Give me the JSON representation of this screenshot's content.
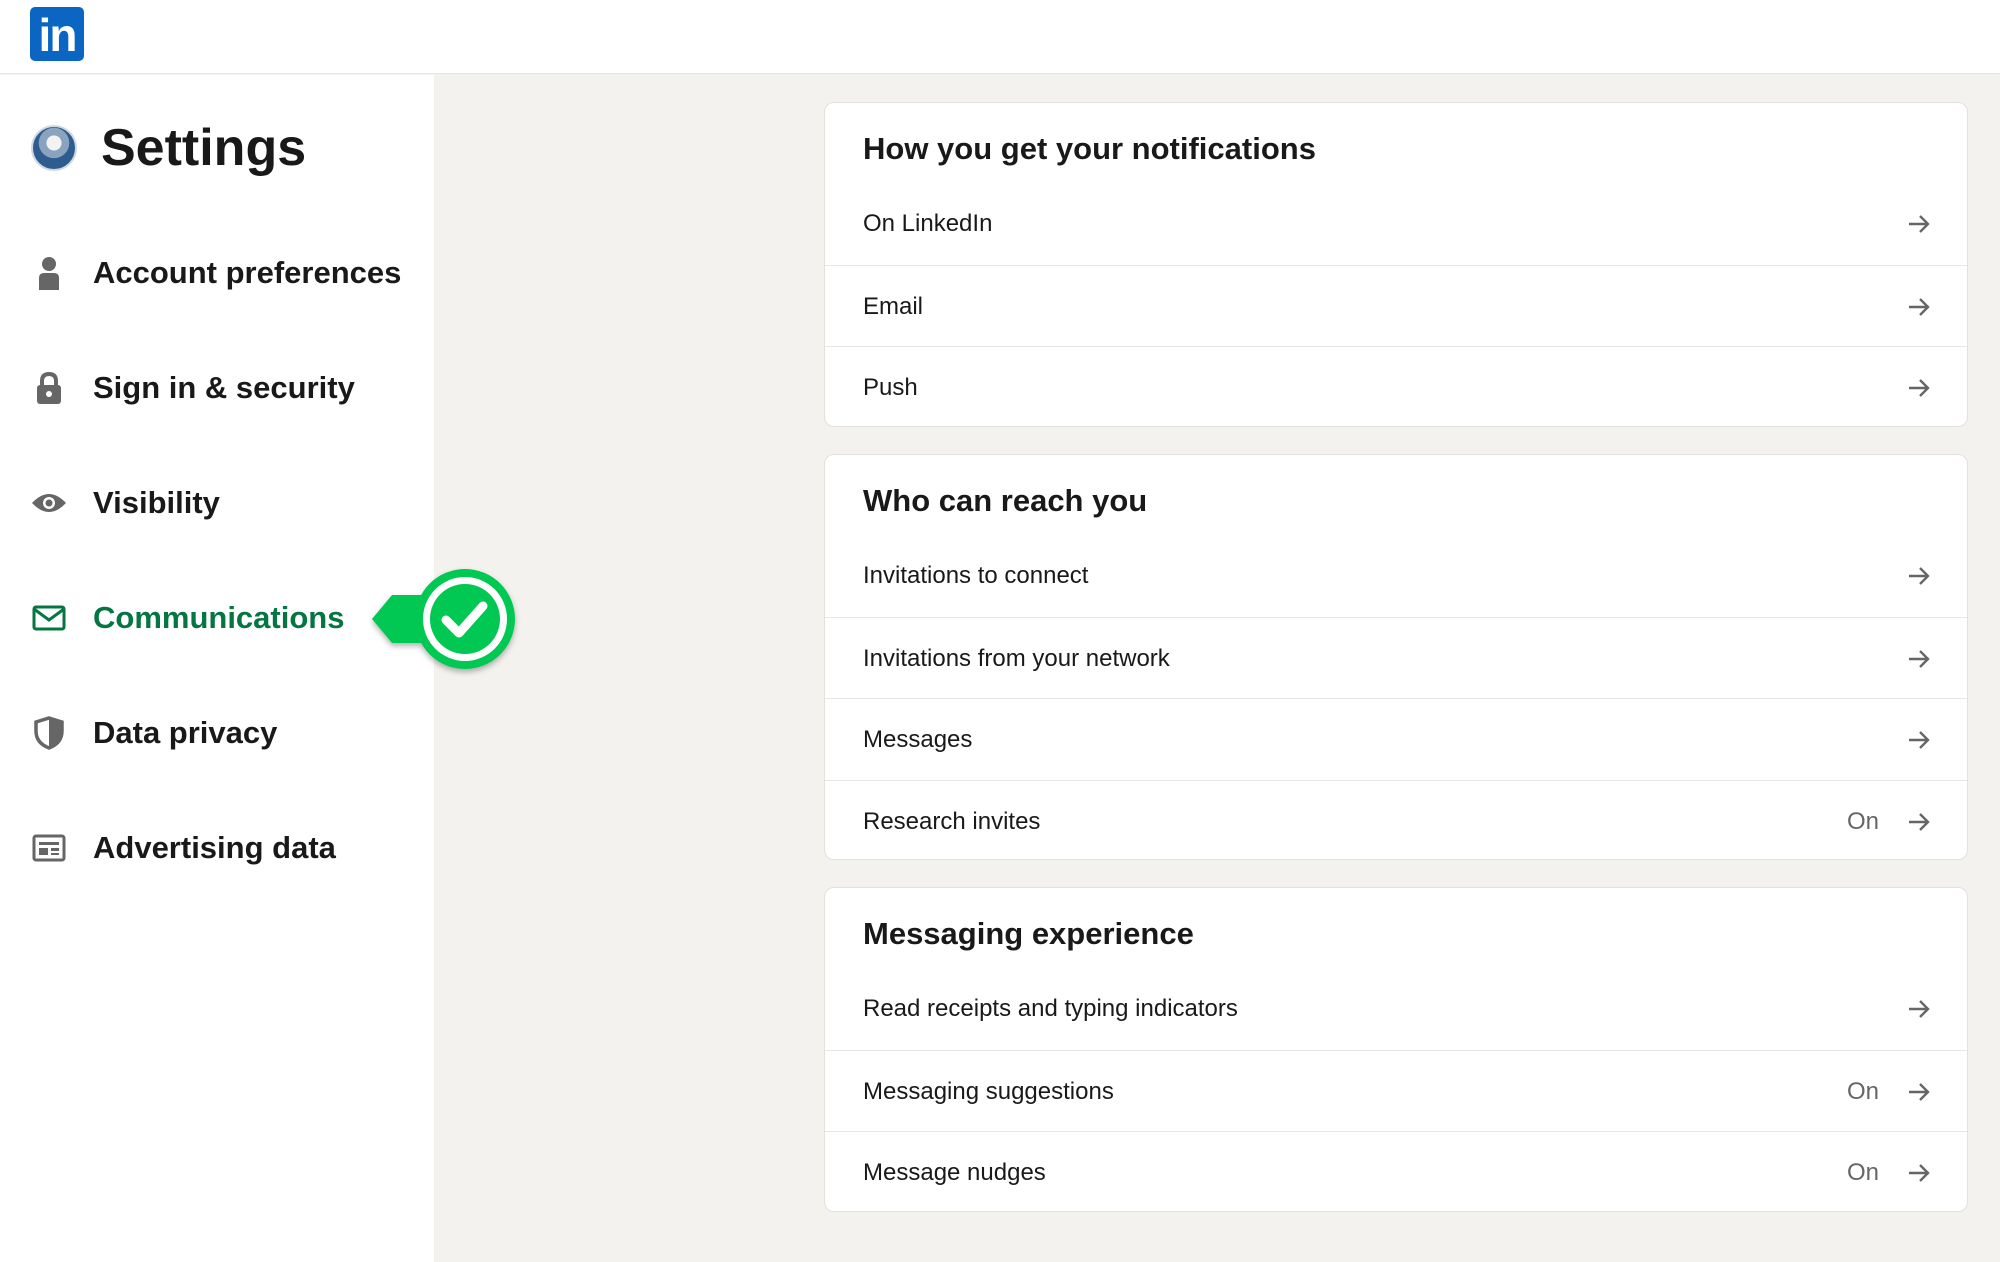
{
  "app": {
    "logo_text": "in"
  },
  "sidebar": {
    "title": "Settings",
    "items": [
      {
        "label": "Account preferences",
        "icon": "person-icon"
      },
      {
        "label": "Sign in & security",
        "icon": "lock-icon"
      },
      {
        "label": "Visibility",
        "icon": "eye-icon"
      },
      {
        "label": "Communications",
        "icon": "envelope-icon",
        "active": true
      },
      {
        "label": "Data privacy",
        "icon": "shield-icon"
      },
      {
        "label": "Advertising data",
        "icon": "ad-icon"
      }
    ]
  },
  "colors": {
    "brand": "#0a66c2",
    "active_nav": "#057642",
    "callout_green": "#00c853",
    "background": "#f4f2ee"
  },
  "sections": [
    {
      "title": "How you get your notifications",
      "rows": [
        {
          "label": "On LinkedIn",
          "status": ""
        },
        {
          "label": "Email",
          "status": ""
        },
        {
          "label": "Push",
          "status": ""
        }
      ]
    },
    {
      "title": "Who can reach you",
      "rows": [
        {
          "label": "Invitations to connect",
          "status": ""
        },
        {
          "label": "Invitations from your network",
          "status": ""
        },
        {
          "label": "Messages",
          "status": ""
        },
        {
          "label": "Research invites",
          "status": "On"
        }
      ]
    },
    {
      "title": "Messaging experience",
      "rows": [
        {
          "label": "Read receipts and typing indicators",
          "status": ""
        },
        {
          "label": "Messaging suggestions",
          "status": "On"
        },
        {
          "label": "Message nudges",
          "status": "On"
        }
      ]
    }
  ]
}
